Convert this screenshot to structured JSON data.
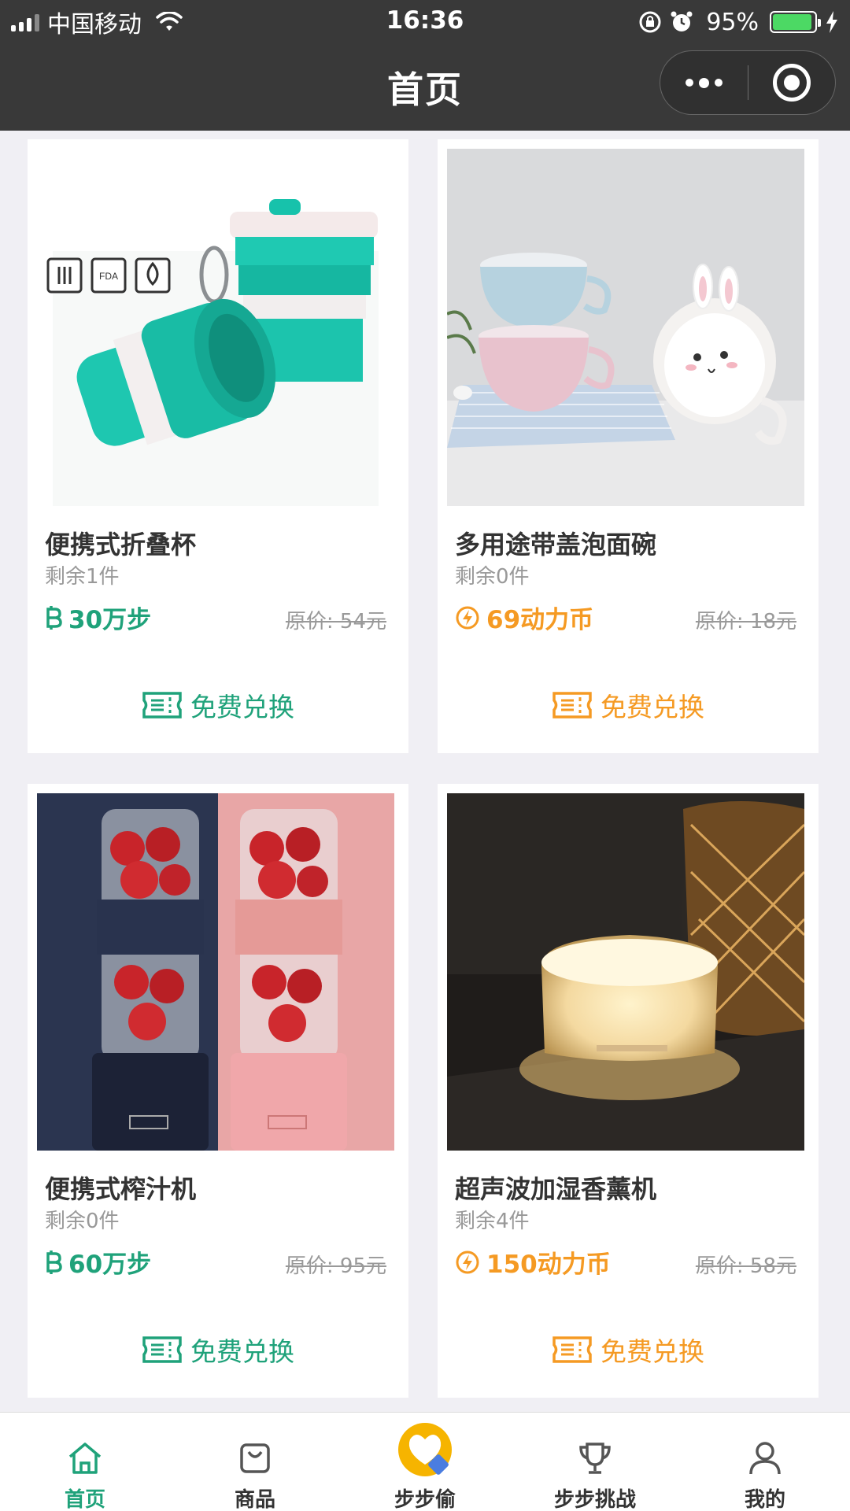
{
  "status_bar": {
    "carrier": "中国移动",
    "time": "16:36",
    "battery": "95%"
  },
  "nav": {
    "title": "首页"
  },
  "products": [
    {
      "name": "便携式折叠杯",
      "stock": "剩余1件",
      "price": "30万步",
      "price_type": "steps",
      "original_price": "原价: 54元",
      "action": "免费兑换"
    },
    {
      "name": "多用途带盖泡面碗",
      "stock": "剩余0件",
      "price": "69动力币",
      "price_type": "coins",
      "original_price": "原价: 18元",
      "action": "免费兑换"
    },
    {
      "name": "便携式榨汁机",
      "stock": "剩余0件",
      "price": "60万步",
      "price_type": "steps",
      "original_price": "原价: 95元",
      "action": "免费兑换"
    },
    {
      "name": "超声波加湿香薰机",
      "stock": "剩余4件",
      "price": "150动力币",
      "price_type": "coins",
      "original_price": "原价: 58元",
      "action": "免费兑换"
    }
  ],
  "tabs": [
    {
      "label": "首页",
      "icon": "home-icon",
      "active": true
    },
    {
      "label": "商品",
      "icon": "bag-icon",
      "active": false
    },
    {
      "label": "步步偷",
      "icon": "heart-logo-icon",
      "active": false
    },
    {
      "label": "步步挑战",
      "icon": "trophy-icon",
      "active": false
    },
    {
      "label": "我的",
      "icon": "person-icon",
      "active": false
    }
  ],
  "colors": {
    "accent_green": "#1fa27a",
    "accent_orange": "#f59a23",
    "topbar": "#393939",
    "background": "#f0eff4"
  }
}
